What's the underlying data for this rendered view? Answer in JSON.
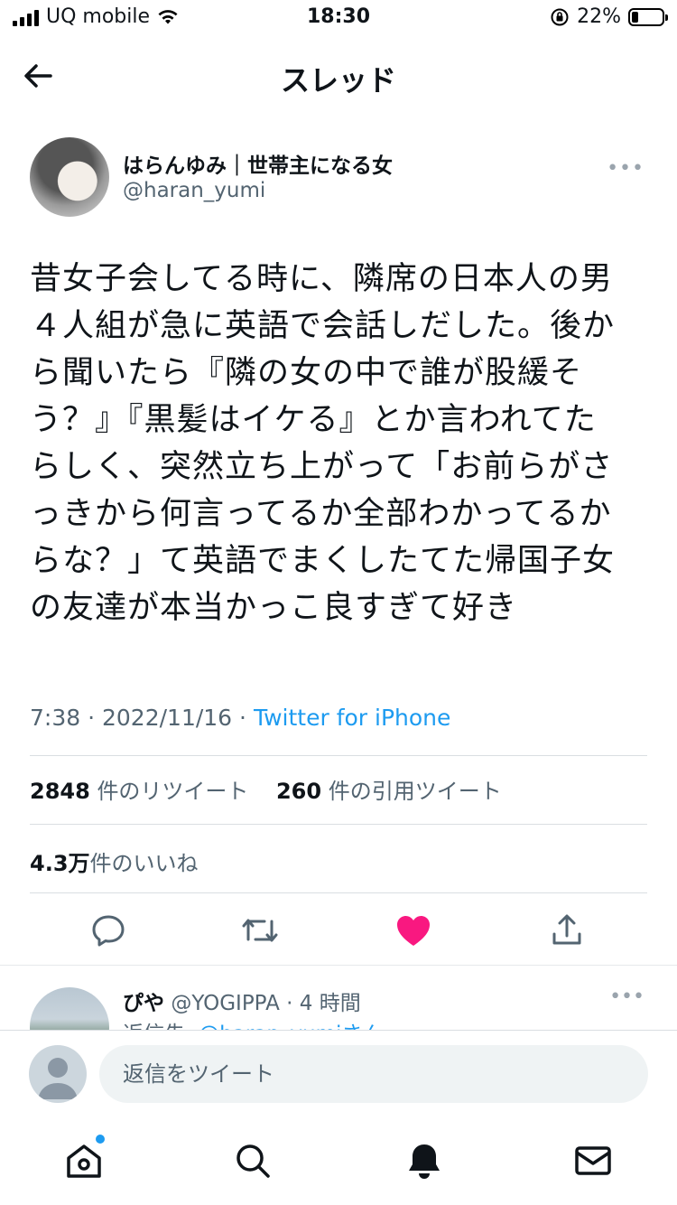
{
  "status_bar": {
    "carrier": "UQ mobile",
    "time": "18:30",
    "battery": "22%",
    "battery_level": 0.22
  },
  "header": {
    "title": "スレッド"
  },
  "tweet": {
    "author_name": "はらんゆみ｜世帯主になる女",
    "author_handle": "@haran_yumi",
    "lines": [
      "昔女子会してる時に、隣席の日本人の男",
      "４人組が急に英語で会話しだした。後か",
      "ら聞いたら『隣の女の中で誰が股緩そ",
      "う？』『黒髪はイケる』とか言われてた",
      "らしく、突然立ち上がって「お前らがさ",
      "っきから何言ってるか全部わかってるか",
      "らな？」て英語でまくしたてた帰国子女",
      "の友達が本当かっこ良すぎて好き"
    ],
    "time": "7:38",
    "date": "2022/11/16",
    "separator": "·",
    "source": "Twitter for iPhone",
    "retweets_count": "2848",
    "retweets_label": "件のリツイート",
    "quotes_count": "260",
    "quotes_label": "件の引用ツイート",
    "likes_count": "4.3万",
    "likes_label": "件のいいね",
    "liked": true,
    "like_color": "#f91880"
  },
  "reply": {
    "name": "ぴや",
    "handle": "@YOGIPPA",
    "age": "· 4 時間",
    "to_prefix": "返信先: ",
    "to_handle": "@haran_yumiさん"
  },
  "composer": {
    "placeholder": "返信をツイート"
  },
  "icons": {
    "back": "arrow-left-icon",
    "more": "more-dots-icon",
    "reply": "comment-icon",
    "retweet": "retweet-icon",
    "like": "heart-filled-icon",
    "share": "share-icon",
    "home": "home-icon",
    "search": "search-icon",
    "notifications": "bell-icon",
    "messages": "envelope-icon"
  },
  "colors": {
    "accent": "#1d9bf0",
    "secondary_text": "#536471"
  }
}
